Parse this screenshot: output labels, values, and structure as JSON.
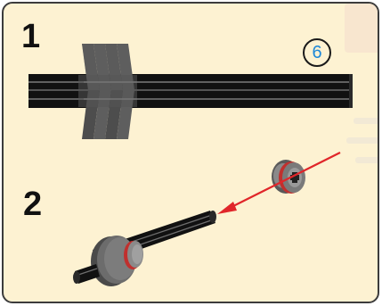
{
  "steps": [
    {
      "number": "1"
    },
    {
      "number": "2"
    }
  ],
  "part_count_badge": "6",
  "colors": {
    "panel_background": "#fdf2d2",
    "border": "#3c3c3c",
    "axle_black": "#111111",
    "worm_gear_gray": "#555555",
    "bushing_gray": "#6c6c6c",
    "bushing_red": "#c0302e",
    "arrow_red": "#e0262a",
    "badge_text_blue": "#1e88d8"
  },
  "parts": [
    "axle-icon",
    "worm-gear-icon",
    "bushing-icon",
    "arrow-icon"
  ]
}
